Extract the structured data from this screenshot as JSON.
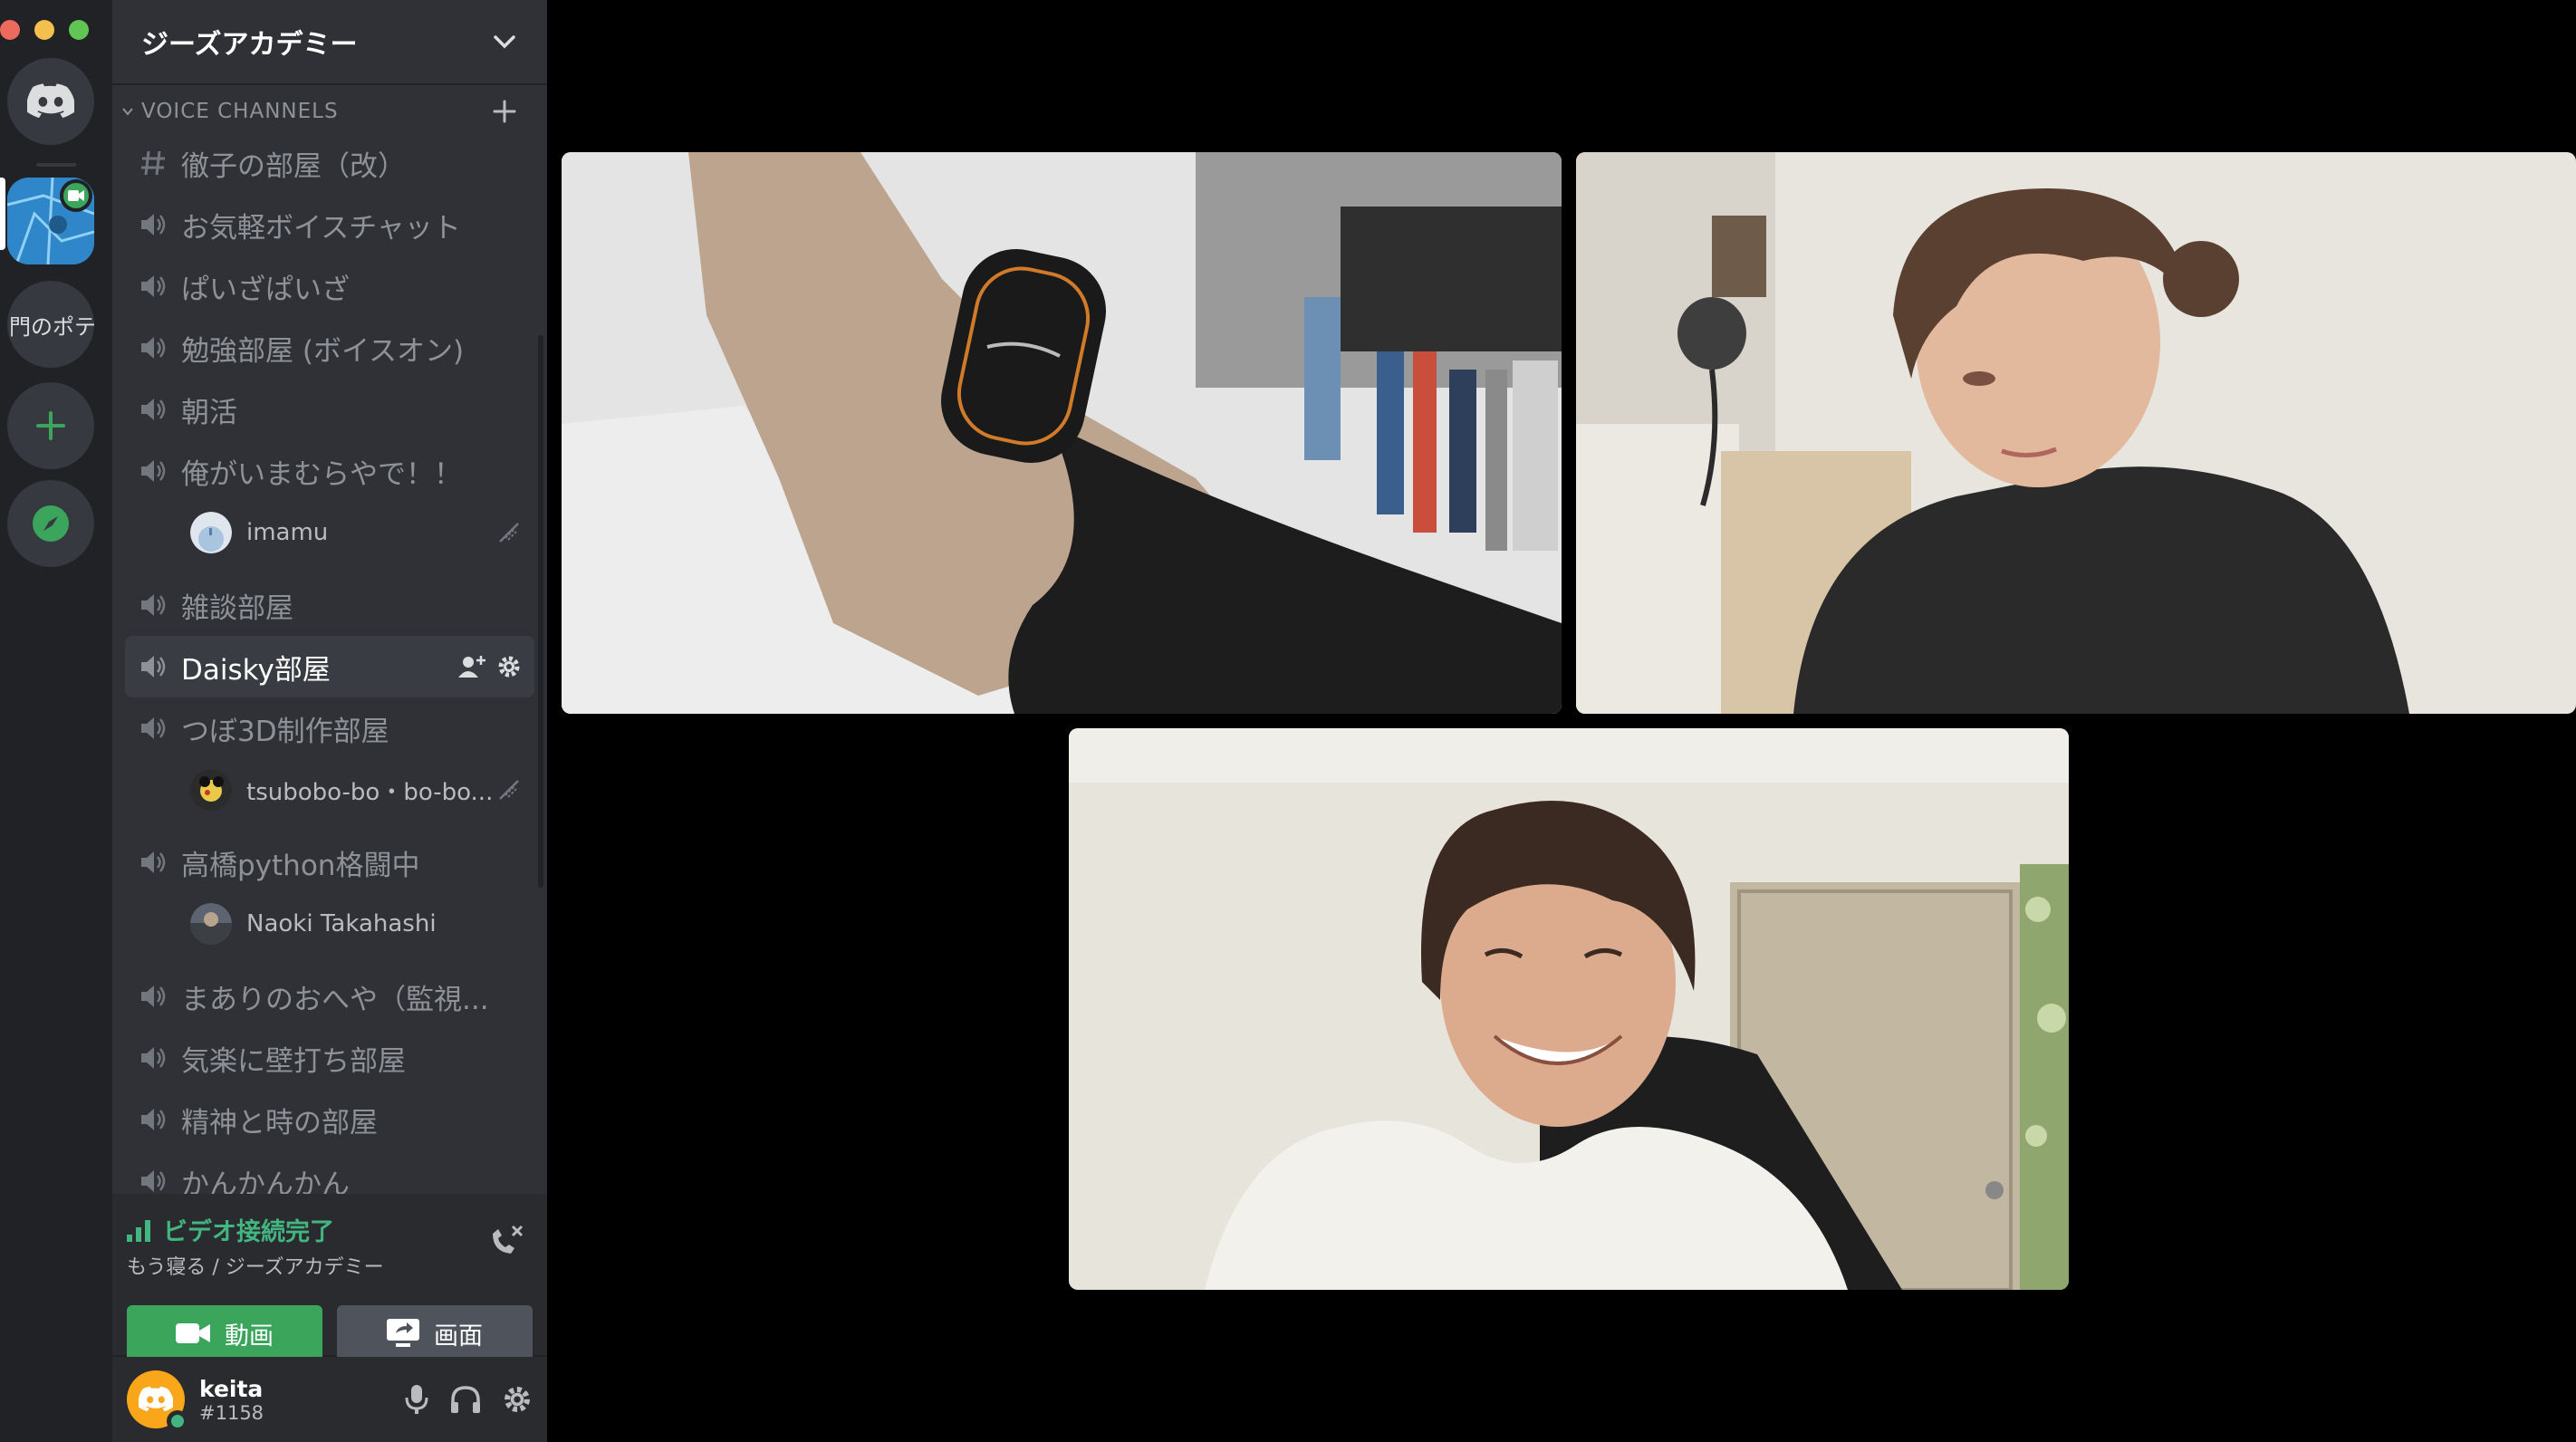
{
  "window": {
    "traffic_lights": [
      "#ed6a5e",
      "#f5bf4f",
      "#61c554"
    ]
  },
  "server_rail": {
    "home_icon": "discord-logo-icon",
    "partial_server_label": "門のポテ",
    "add_server_icon": "plus-icon",
    "explore_icon": "compass-icon",
    "accent_green": "#3ba55c"
  },
  "server": {
    "name": "ジーズアカデミー"
  },
  "category": {
    "label": "VOICE CHANNELS"
  },
  "channels": [
    {
      "type": "text",
      "label": "徹子の部屋（改）"
    },
    {
      "type": "voice",
      "label": "お気軽ボイスチャット"
    },
    {
      "type": "voice",
      "label": "ぱいざぱいざ"
    },
    {
      "type": "voice",
      "label": "勉強部屋 (ボイスオン)"
    },
    {
      "type": "voice",
      "label": "朝活"
    },
    {
      "type": "voice",
      "label": "俺がいまむらやで！！",
      "members": [
        {
          "name": "imamu"
        }
      ]
    },
    {
      "type": "voice",
      "label": "雑談部屋"
    },
    {
      "type": "voice",
      "label": "Daisky部屋",
      "selected": true
    },
    {
      "type": "voice",
      "label": "つぼ3D制作部屋",
      "members": [
        {
          "name": "tsubobo-bo・bo-bo..."
        }
      ]
    },
    {
      "type": "voice",
      "label": "高橋python格闘中",
      "members": [
        {
          "name": "Naoki Takahashi"
        }
      ]
    },
    {
      "type": "voice",
      "label": "まありのおへや（監視..."
    },
    {
      "type": "voice",
      "label": "気楽に壁打ち部屋"
    },
    {
      "type": "voice",
      "label": "精神と時の部屋"
    },
    {
      "type": "voice",
      "label": "かんかんかん"
    }
  ],
  "voice_panel": {
    "status": "ビデオ接続完了",
    "location": "もう寝る / ジーズアカデミー",
    "video_label": "動画",
    "screen_label": "画面"
  },
  "user": {
    "name": "keita",
    "tag": "#1158"
  },
  "video_tiles": [
    {
      "name": "video-tile-arm"
    },
    {
      "name": "video-tile-woman"
    },
    {
      "name": "video-tile-man"
    }
  ]
}
